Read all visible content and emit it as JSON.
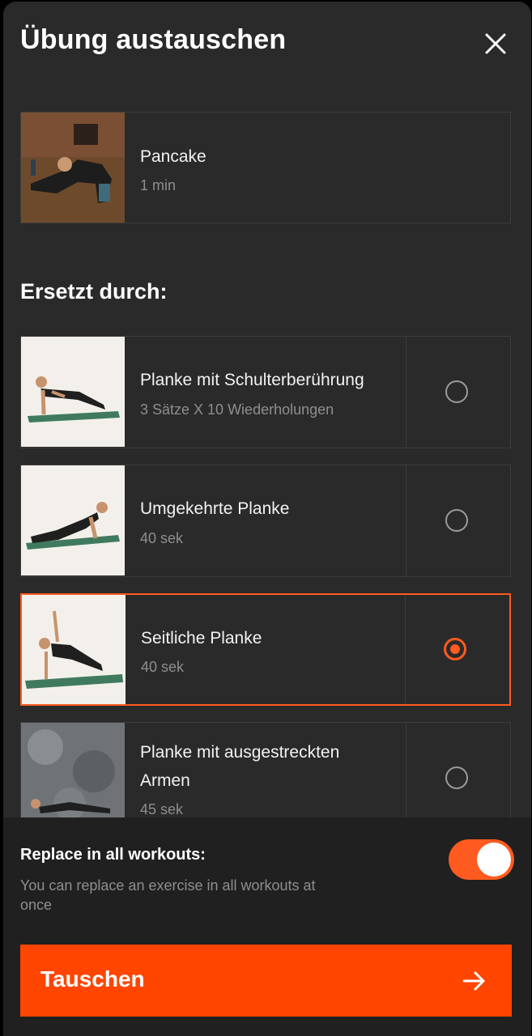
{
  "header": {
    "title": "Übung austauschen",
    "close_icon": "close-icon"
  },
  "current_exercise": {
    "title": "Pancake",
    "duration": "1 min"
  },
  "replace_section": {
    "heading": "Ersetzt durch:"
  },
  "options": [
    {
      "title_line1": "Planke mit Schulterberührung",
      "title_line2": "",
      "detail": "3 Sätze X 10 Wiederholungen",
      "selected": false
    },
    {
      "title_line1": "Umgekehrte Planke",
      "title_line2": "",
      "detail": "40 sek",
      "selected": false
    },
    {
      "title_line1": "Seitliche Planke",
      "title_line2": "",
      "detail": "40 sek",
      "selected": true
    },
    {
      "title_line1": "Planke mit ausgestreckten",
      "title_line2": "Armen",
      "detail": "45 sek",
      "selected": false
    }
  ],
  "replace_all": {
    "title": "Replace in all workouts:",
    "description": "You can replace an exercise in all workouts at once",
    "enabled": true
  },
  "action": {
    "label": "Tauschen",
    "icon": "arrow-right-icon"
  },
  "colors": {
    "accent": "#ff5a1f",
    "button": "#ff4500",
    "background": "#2a2a2a"
  }
}
